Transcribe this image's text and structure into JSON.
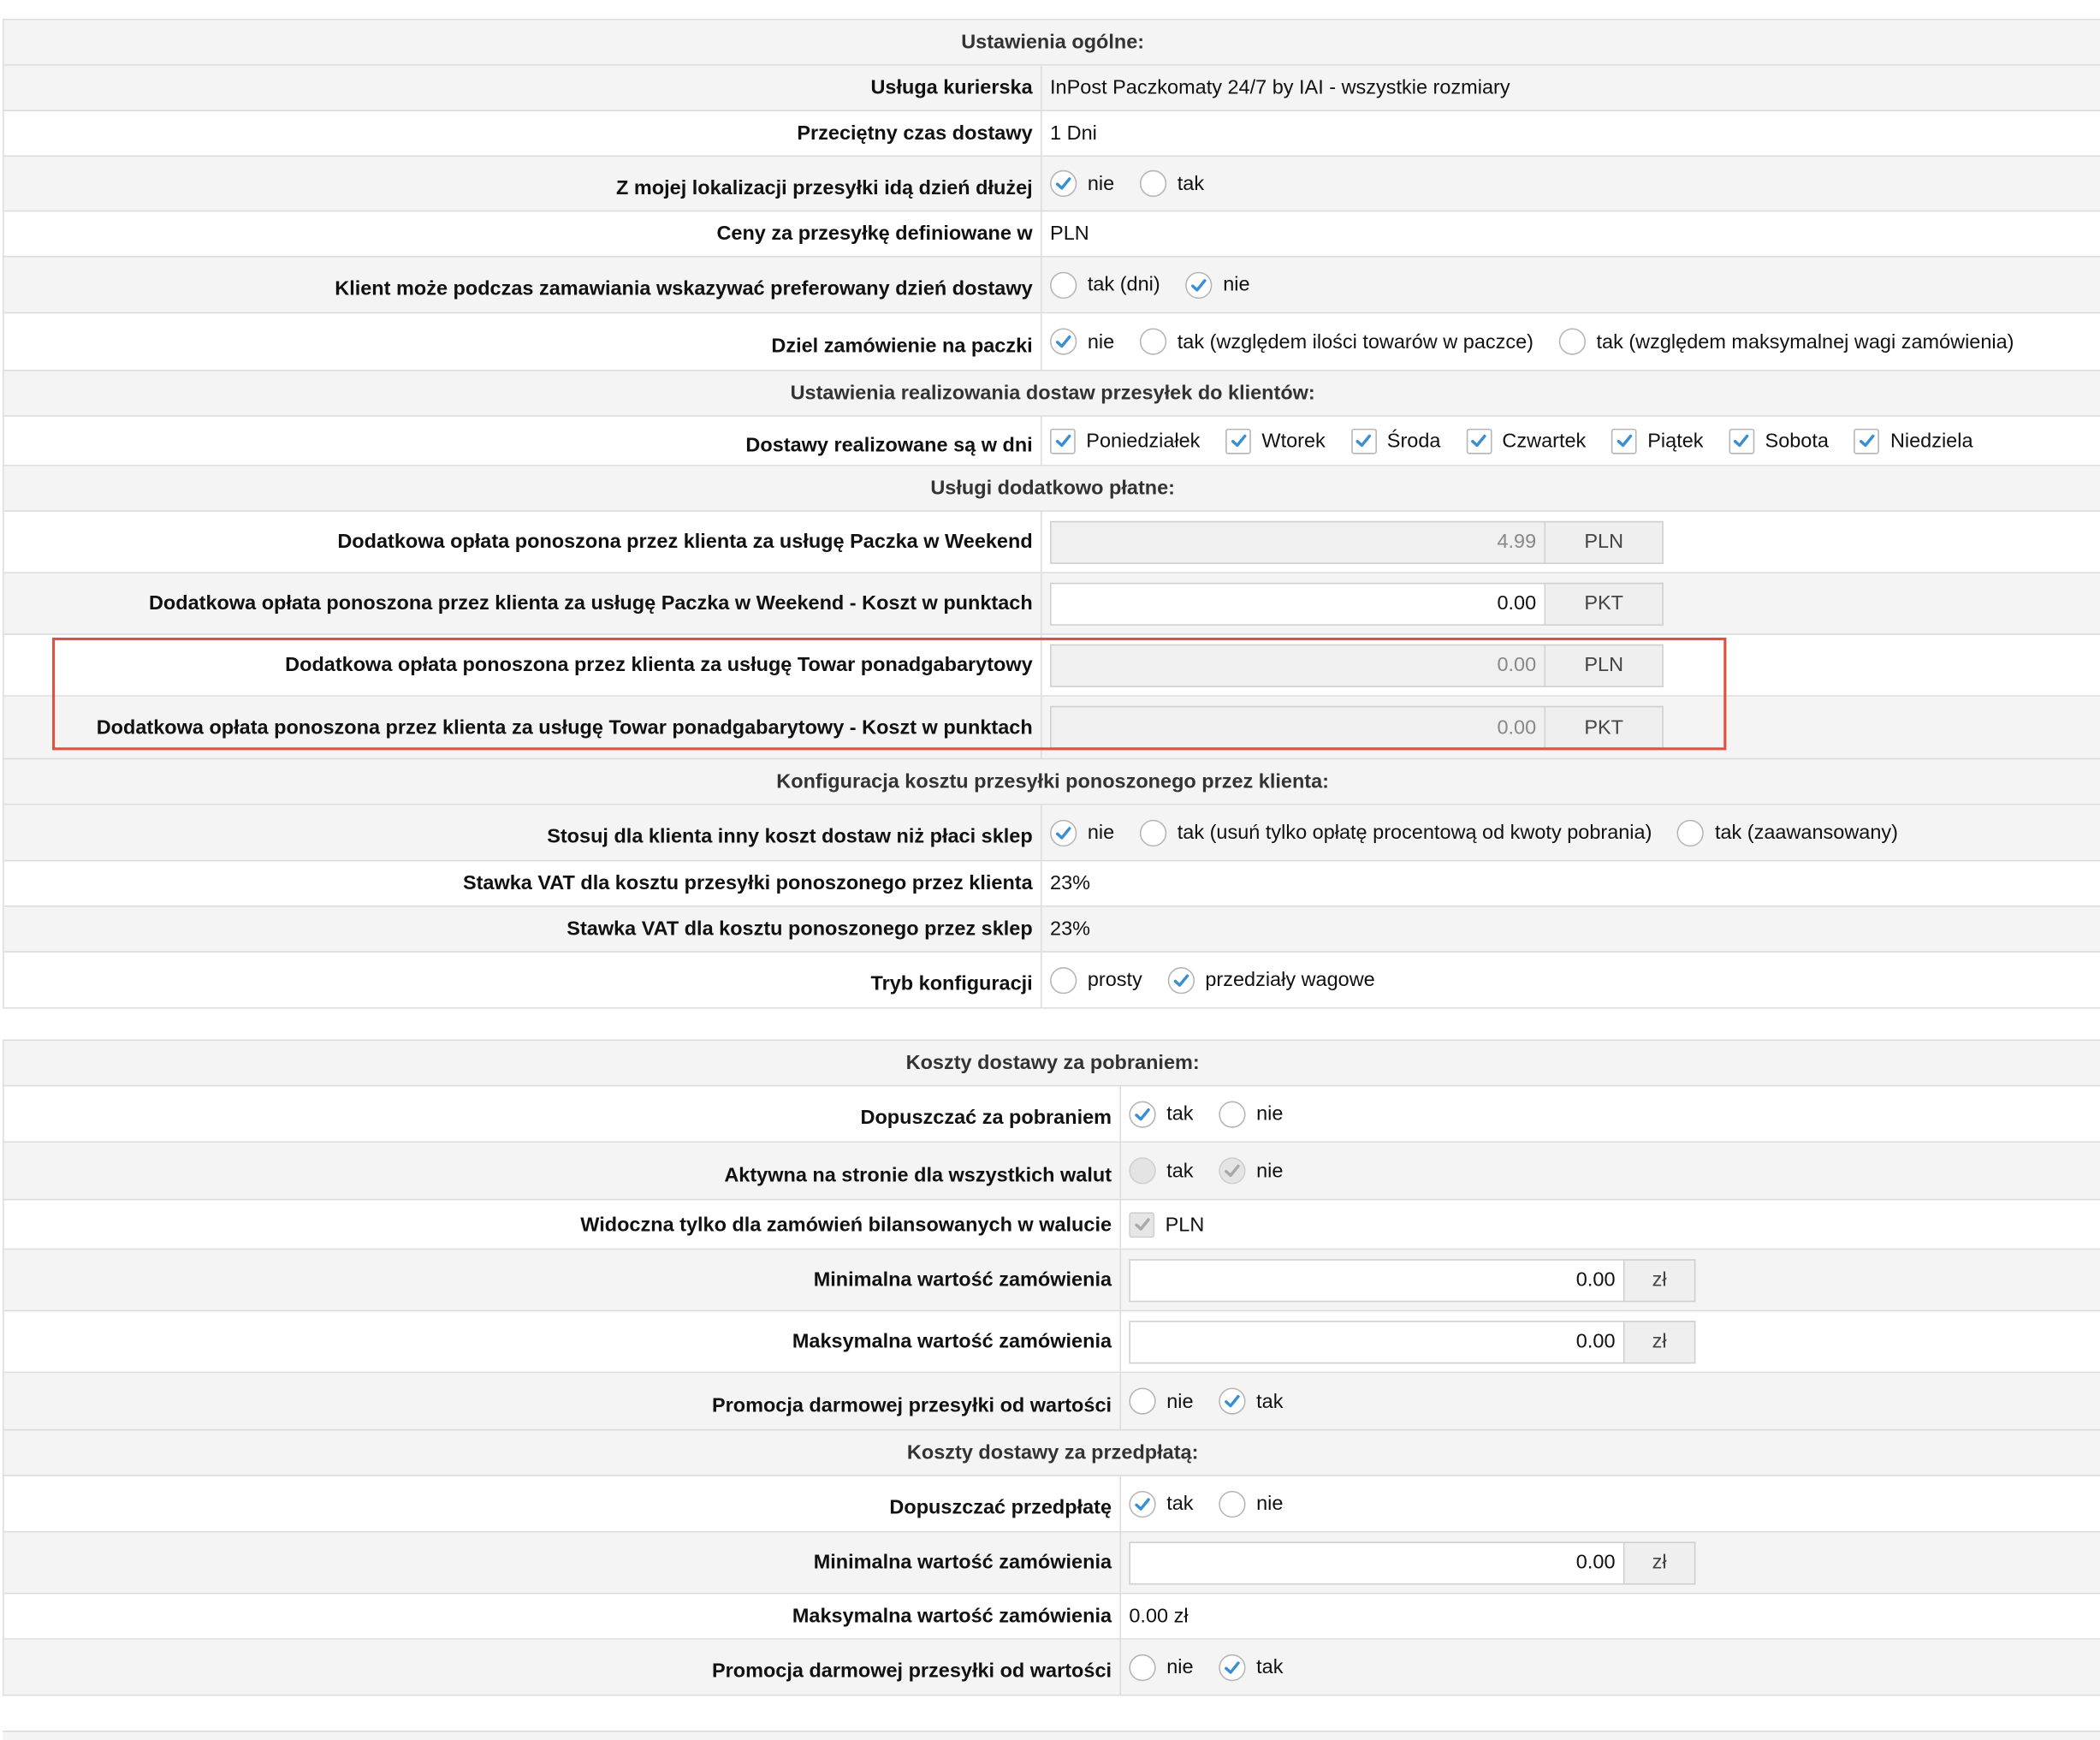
{
  "general": {
    "title": "Ustawienia ogólne:",
    "courier_label": "Usługa kurierska",
    "courier_value": "InPost Paczkomaty 24/7 by IAI - wszystkie rozmiary",
    "avg_time_label": "Przeciętny czas dostawy",
    "avg_time_value": "1 Dni",
    "day_longer_label": "Z mojej lokalizacji przesyłki idą dzień dłużej",
    "day_longer_opts": [
      "nie",
      "tak"
    ],
    "prices_label": "Ceny za przesyłkę definiowane w",
    "prices_value": "PLN",
    "pref_day_label": "Klient może podczas zamawiania wskazywać preferowany dzień dostawy",
    "pref_day_opts": [
      "tak (dni)",
      "nie"
    ],
    "split_label": "Dziel zamówienie na paczki",
    "split_opts": [
      "nie",
      "tak (względem ilości towarów w paczce)",
      "tak (względem maksymalnej wagi zamówienia)"
    ]
  },
  "delivery_days": {
    "title": "Ustawienia realizowania dostaw przesyłek do klientów:",
    "label": "Dostawy realizowane są w dni",
    "days": [
      "Poniedziałek",
      "Wtorek",
      "Środa",
      "Czwartek",
      "Piątek",
      "Sobota",
      "Niedziela"
    ]
  },
  "extra": {
    "title": "Usługi dodatkowo płatne:",
    "rows": [
      {
        "label": "Dodatkowa opłata ponoszona przez klienta za usługę Paczka w Weekend",
        "value": "4.99",
        "unit": "PLN"
      },
      {
        "label": "Dodatkowa opłata ponoszona przez klienta za usługę Paczka w Weekend - Koszt w punktach",
        "value": "0.00",
        "unit": "PKT"
      },
      {
        "label": "Dodatkowa opłata ponoszona przez klienta za usługę Towar ponadgabarytowy",
        "value": "0.00",
        "unit": "PLN"
      },
      {
        "label": "Dodatkowa opłata ponoszona przez klienta za usługę Towar ponadgabarytowy - Koszt w punktach",
        "value": "0.00",
        "unit": "PKT"
      }
    ]
  },
  "cost_config": {
    "title": "Konfiguracja kosztu przesyłki ponoszonego przez klienta:",
    "other_cost_label": "Stosuj dla klienta inny koszt dostaw niż płaci sklep",
    "other_cost_opts": [
      "nie",
      "tak (usuń tylko opłatę procentową od kwoty pobrania)",
      "tak (zaawansowany)"
    ],
    "vat_client_label": "Stawka VAT dla kosztu przesyłki ponoszonego przez klienta",
    "vat_client_value": "23%",
    "vat_shop_label": "Stawka VAT dla kosztu ponoszonego przez sklep",
    "vat_shop_value": "23%",
    "mode_label": "Tryb konfiguracji",
    "mode_opts": [
      "prosty",
      "przedziały wagowe"
    ]
  },
  "cod": {
    "title": "Koszty dostawy za pobraniem:",
    "allow_label": "Dopuszczać za pobraniem",
    "allow_opts": [
      "tak",
      "nie"
    ],
    "all_curr_label": "Aktywna na stronie dla wszystkich walut",
    "all_curr_opts": [
      "tak",
      "nie"
    ],
    "balanced_label": "Widoczna tylko dla zamówień bilansowanych w walucie",
    "balanced_value": "PLN",
    "min_label": "Minimalna wartość zamówienia",
    "min_value": "0.00",
    "min_unit": "zł",
    "max_label": "Maksymalna wartość zamówienia",
    "max_value": "0.00",
    "max_unit": "zł",
    "promo_label": "Promocja darmowej przesyłki od wartości",
    "promo_opts": [
      "nie",
      "tak"
    ]
  },
  "prepaid": {
    "title": "Koszty dostawy za przedpłatą:",
    "allow_label": "Dopuszczać przedpłatę",
    "allow_opts": [
      "tak",
      "nie"
    ],
    "min_label": "Minimalna wartość zamówienia",
    "min_value": "0.00",
    "min_unit": "zł",
    "max_label": "Maksymalna wartość zamówienia",
    "max_value": "0.00 zł",
    "promo_label": "Promocja darmowej przesyłki od wartości",
    "promo_opts": [
      "nie",
      "tak"
    ]
  },
  "icons": {
    "check_color": "#3a8fd0",
    "highlight_color": "#e05040"
  }
}
